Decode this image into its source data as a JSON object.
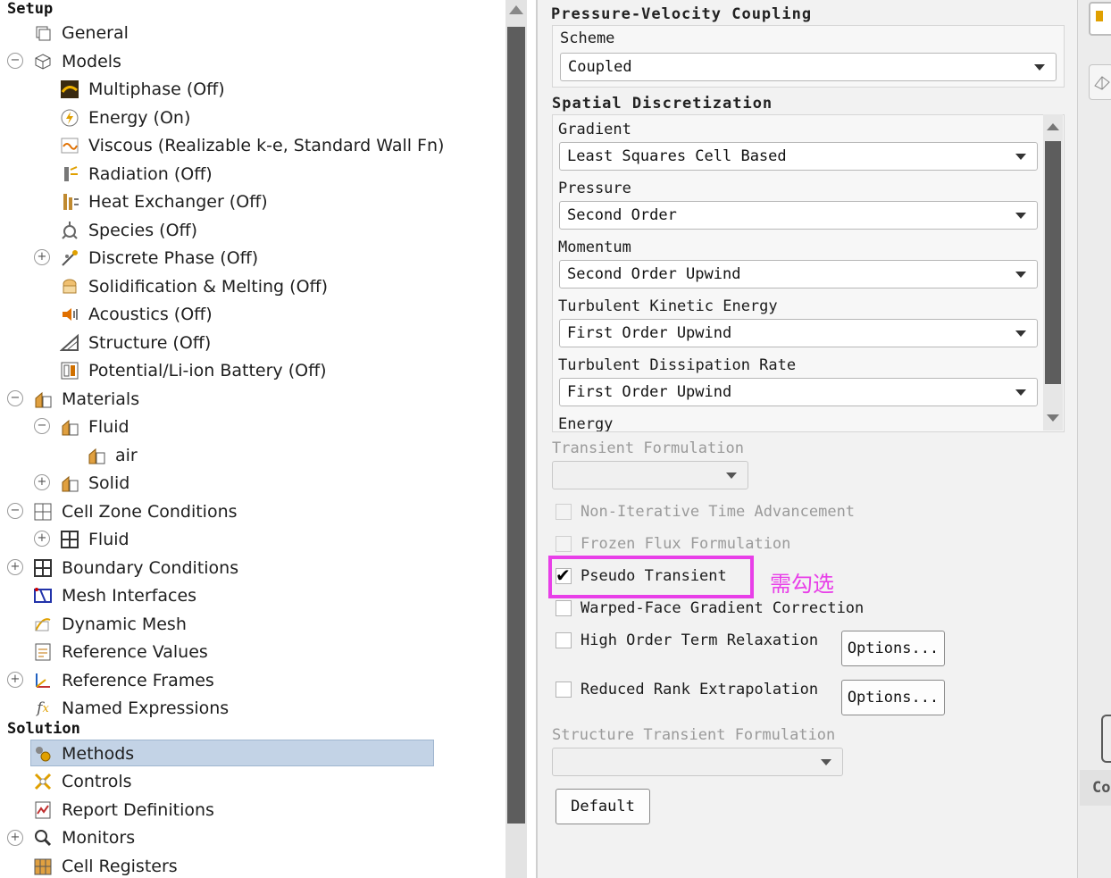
{
  "tree": {
    "setup_label": "Setup",
    "solution_label": "Solution",
    "items": [
      {
        "label": "General"
      },
      {
        "label": "Models"
      },
      {
        "label": "Multiphase (Off)"
      },
      {
        "label": "Energy (On)"
      },
      {
        "label": "Viscous (Realizable k-e, Standard Wall Fn)"
      },
      {
        "label": "Radiation (Off)"
      },
      {
        "label": "Heat Exchanger (Off)"
      },
      {
        "label": "Species (Off)"
      },
      {
        "label": "Discrete Phase (Off)"
      },
      {
        "label": "Solidification & Melting (Off)"
      },
      {
        "label": "Acoustics (Off)"
      },
      {
        "label": "Structure (Off)"
      },
      {
        "label": "Potential/Li-ion Battery (Off)"
      },
      {
        "label": "Materials"
      },
      {
        "label": "Fluid"
      },
      {
        "label": "air"
      },
      {
        "label": "Solid"
      },
      {
        "label": "Cell Zone Conditions"
      },
      {
        "label": "Fluid"
      },
      {
        "label": "Boundary Conditions"
      },
      {
        "label": "Mesh Interfaces"
      },
      {
        "label": "Dynamic Mesh"
      },
      {
        "label": "Reference Values"
      },
      {
        "label": "Reference Frames"
      },
      {
        "label": "Named Expressions"
      },
      {
        "label": "Methods"
      },
      {
        "label": "Controls"
      },
      {
        "label": "Report Definitions"
      },
      {
        "label": "Monitors"
      },
      {
        "label": "Cell Registers"
      }
    ]
  },
  "methods": {
    "pv_coupling_title": "Pressure-Velocity Coupling",
    "scheme_label": "Scheme",
    "scheme_value": "Coupled",
    "spatial_title": "Spatial Discretization",
    "discretization": [
      {
        "label": "Gradient",
        "value": "Least Squares Cell Based"
      },
      {
        "label": "Pressure",
        "value": "Second Order"
      },
      {
        "label": "Momentum",
        "value": "Second Order Upwind"
      },
      {
        "label": "Turbulent Kinetic Energy",
        "value": "First Order Upwind"
      },
      {
        "label": "Turbulent Dissipation Rate",
        "value": "First Order Upwind"
      },
      {
        "label": "Energy",
        "value": ""
      }
    ],
    "transient_formulation_label": "Transient Formulation",
    "transient_formulation_value": "",
    "checkboxes": [
      {
        "label": "Non-Iterative Time Advancement",
        "checked": false,
        "enabled": false
      },
      {
        "label": "Frozen Flux Formulation",
        "checked": false,
        "enabled": false
      },
      {
        "label": "Pseudo Transient",
        "checked": true,
        "enabled": true
      },
      {
        "label": "Warped-Face Gradient Correction",
        "checked": false,
        "enabled": true
      },
      {
        "label": "High Order Term Relaxation",
        "checked": false,
        "enabled": true
      },
      {
        "label": "Reduced Rank Extrapolation",
        "checked": false,
        "enabled": true
      }
    ],
    "options_button_label": "Options...",
    "structure_transient_label": "Structure Transient Formulation",
    "structure_transient_value": "",
    "default_button_label": "Default"
  },
  "annotation": {
    "note": "需勾选",
    "color": "#e83fe8"
  },
  "right_strip": {
    "partial_label": "Co"
  }
}
